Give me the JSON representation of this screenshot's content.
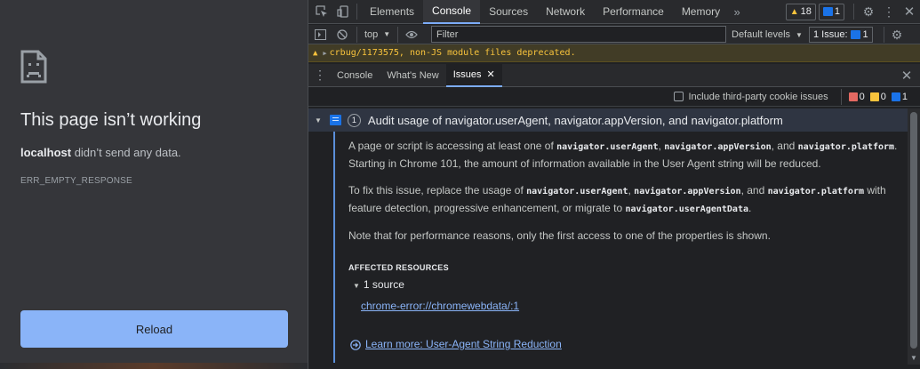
{
  "error_page": {
    "title": "This page isn’t working",
    "host": "localhost",
    "message": " didn’t send any data.",
    "code": "ERR_EMPTY_RESPONSE",
    "reload_label": "Reload"
  },
  "devtools": {
    "tabs": [
      "Elements",
      "Console",
      "Sources",
      "Network",
      "Performance",
      "Memory"
    ],
    "active_tab": "Console",
    "warnings_count": "18",
    "issues_count": "1",
    "context": "top",
    "filter_placeholder": "Filter",
    "levels": "Default levels",
    "issues_badge_label": "1 Issue:",
    "issues_badge_count": "1",
    "warning_text": "crbug/1173575, non-JS module files deprecated.",
    "drawer_tabs": [
      "Console",
      "What's New",
      "Issues"
    ],
    "active_drawer_tab": "Issues",
    "third_party_label": "Include third-party cookie issues",
    "counts": {
      "errors": "0",
      "warnings": "0",
      "info": "1"
    },
    "issue": {
      "count": "1",
      "title": "Audit usage of navigator.userAgent, navigator.appVersion, and navigator.platform",
      "p1_a": "A page or script is accessing at least one of ",
      "p1_c1": "navigator.userAgent",
      "p1_s1": ", ",
      "p1_c2": "navigator.appVersion",
      "p1_s2": ", and ",
      "p1_c3": "navigator.platform",
      "p1_b": ". Starting in Chrome 101, the amount of information available in the User Agent string will be reduced.",
      "p2_a": "To fix this issue, replace the usage of ",
      "p2_c1": "navigator.userAgent",
      "p2_s1": ", ",
      "p2_c2": "navigator.appVersion",
      "p2_s2": ", and ",
      "p2_c3": "navigator.platform",
      "p2_b": " with feature detection, progressive enhancement, or migrate to ",
      "p2_c4": "navigator.userAgentData",
      "p2_end": ".",
      "p3": "Note that for performance reasons, only the first access to one of the properties is shown.",
      "affected_label": "AFFECTED RESOURCES",
      "sources_toggle": "1 source",
      "source_link": "chrome-error://chromewebdata/:1",
      "learn_more": "Learn more: User-Agent String Reduction"
    }
  },
  "colors": {
    "accent": "#8ab4f8",
    "warning": "#f8c33c",
    "error": "#e46962",
    "info": "#1a73e8"
  }
}
